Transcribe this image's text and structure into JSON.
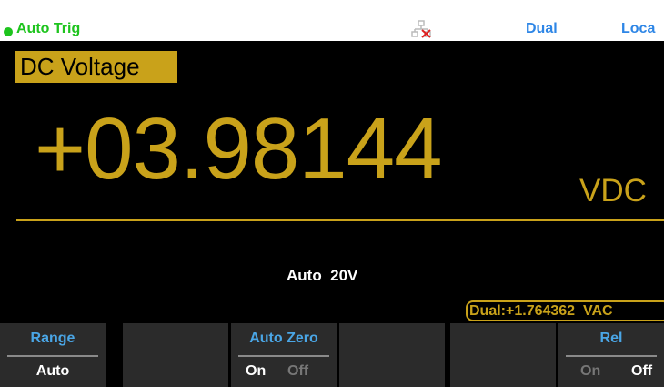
{
  "status": {
    "trigger_label": "Auto Trig",
    "dual_label": "Dual",
    "local_label": "Loca",
    "lan_icon": "network-disconnected-icon",
    "trigger_indicator": "dot-icon"
  },
  "measurement": {
    "function_label": "DC Voltage",
    "reading": "+03.98144",
    "unit": "VDC",
    "range_text": "Auto  20V",
    "dual_reading": "Dual:+1.764362  VAC"
  },
  "softkeys": {
    "range": {
      "title": "Range",
      "value": "Auto"
    },
    "auto_zero": {
      "title": "Auto Zero",
      "on": "On",
      "off": "Off",
      "selected": "On"
    },
    "rel": {
      "title": "Rel",
      "on": "On",
      "off": "Off",
      "selected": "Off"
    }
  },
  "colors": {
    "accent": "#c9a21a",
    "status_green": "#1ec41e",
    "status_blue": "#2e86e6",
    "softkey_bg": "#2b2b2b",
    "softkey_title": "#4aa6e6"
  }
}
